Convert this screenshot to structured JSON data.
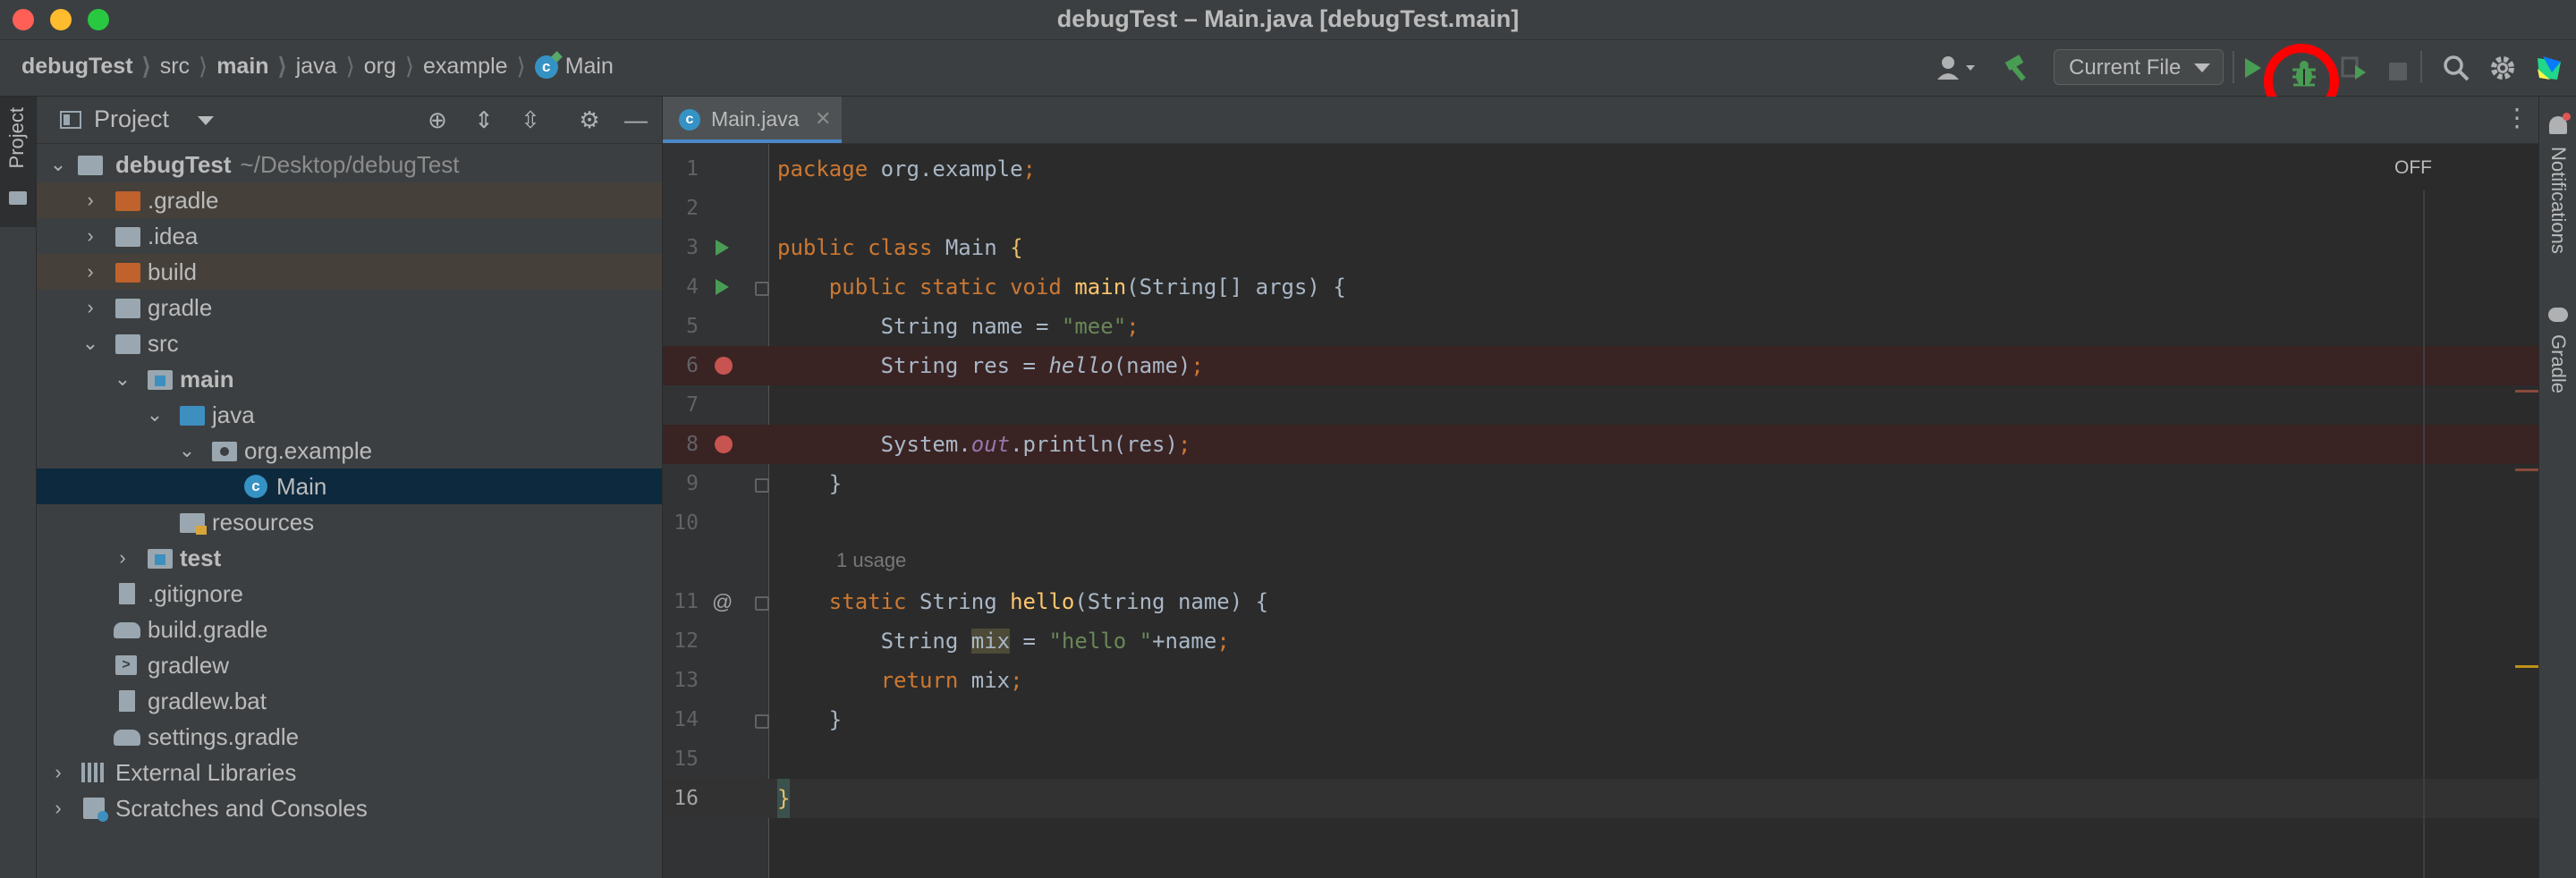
{
  "window": {
    "title": "debugTest – Main.java [debugTest.main]"
  },
  "breadcrumb": [
    {
      "label": "debugTest"
    },
    {
      "label": "src"
    },
    {
      "label": "main"
    },
    {
      "label": "java"
    },
    {
      "label": "org"
    },
    {
      "label": "example"
    },
    {
      "label": "Main"
    }
  ],
  "toolbar": {
    "run_config": "Current File",
    "icons": [
      "user-icon",
      "hammer-icon",
      "run-icon",
      "debug-icon",
      "coverage-icon",
      "stop-icon",
      "search-icon",
      "gear-icon",
      "jetbrains-icon"
    ],
    "accent_color": "#499c54",
    "highlight_color": "#ff0000"
  },
  "left_stripe": {
    "project_label": "Project"
  },
  "right_stripe": {
    "notifications_label": "Notifications",
    "gradle_label": "Gradle"
  },
  "project_panel": {
    "title": "Project",
    "root": {
      "name": "debugTest",
      "path": "~/Desktop/debugTest"
    },
    "items": [
      {
        "label": ".gradle"
      },
      {
        "label": ".idea"
      },
      {
        "label": "build"
      },
      {
        "label": "gradle"
      },
      {
        "label": "src"
      },
      {
        "label": "main"
      },
      {
        "label": "java"
      },
      {
        "label": "org.example"
      },
      {
        "label": "Main"
      },
      {
        "label": "resources"
      },
      {
        "label": "test"
      },
      {
        "label": ".gitignore"
      },
      {
        "label": "build.gradle"
      },
      {
        "label": "gradlew"
      },
      {
        "label": "gradlew.bat"
      },
      {
        "label": "settings.gradle"
      },
      {
        "label": "External Libraries"
      },
      {
        "label": "Scratches and Consoles"
      }
    ]
  },
  "editor": {
    "tab_label": "Main.java",
    "inspection_status": "OFF",
    "usage_hint": "1 usage",
    "line_numbers": [
      "1",
      "2",
      "3",
      "4",
      "5",
      "6",
      "7",
      "8",
      "9",
      "10",
      "11",
      "12",
      "13",
      "14",
      "15",
      "16"
    ],
    "code": {
      "l1_kw": "package",
      "l1_rest": " org.example",
      "l1_semi": ";",
      "l3_kw": "public class",
      "l3_name": " Main ",
      "l3_brace": "{",
      "l4_indent": "    ",
      "l4_kw": "public static void",
      "l4_sp": " ",
      "l4_fn": "main",
      "l4_rest": "(String[] args) {",
      "l5_a": "        String name = ",
      "l5_str": "\"mee\"",
      "l5_semi": ";",
      "l6_a": "        String res = ",
      "l6_fn": "hello",
      "l6_b": "(name)",
      "l6_semi": ";",
      "l8_a": "        System.",
      "l8_fld": "out",
      "l8_b": ".println(res)",
      "l8_semi": ";",
      "l9": "    }",
      "l11_indent": "    ",
      "l11_kw": "static",
      "l11_a": " String ",
      "l11_fn": "hello",
      "l11_b": "(String name) {",
      "l12_a": "        String ",
      "l12_hl": "mix",
      "l12_b": " = ",
      "l12_str": "\"hello \"",
      "l12_c": "+name",
      "l12_semi": ";",
      "l13_indent": "        ",
      "l13_kw": "return",
      "l13_a": " mix",
      "l13_semi": ";",
      "l14": "    }",
      "l16": "}"
    }
  }
}
